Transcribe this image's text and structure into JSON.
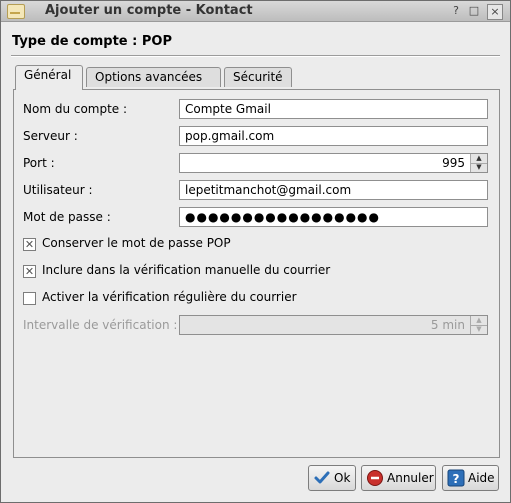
{
  "window": {
    "title": "Ajouter un compte - Kontact",
    "help_btn": "?",
    "minimize_btn": "□",
    "close_btn": "×"
  },
  "header": {
    "title": "Type de compte : POP"
  },
  "tabs": [
    {
      "label": "Général",
      "active": true
    },
    {
      "label": "Options avancées",
      "active": false
    },
    {
      "label": "Sécurité",
      "active": false
    }
  ],
  "form": {
    "account_name": {
      "label": "Nom du compte :",
      "value": "Compte Gmail"
    },
    "server": {
      "label": "Serveur :",
      "value": "pop.gmail.com"
    },
    "port": {
      "label": "Port :",
      "value": "995"
    },
    "user": {
      "label": "Utilisateur :",
      "value": "lepetitmanchot@gmail.com"
    },
    "password": {
      "label": "Mot de passe :",
      "value": "●●●●●●●●●●●●●●●●●"
    },
    "keep_password": {
      "label": "Conserver le mot de passe POP",
      "checked": true
    },
    "include_manual": {
      "label": "Inclure dans la vérification manuelle du courrier",
      "checked": true
    },
    "regular_check": {
      "label": "Activer la vérification régulière du courrier",
      "checked": false
    },
    "interval": {
      "label": "Intervalle de vérification :",
      "value": "5 min"
    }
  },
  "buttons": {
    "ok": "Ok",
    "cancel": "Annuler",
    "help": "Aide"
  },
  "icons": {
    "ok": "check-icon",
    "cancel": "cancel-icon",
    "help": "help-icon"
  }
}
